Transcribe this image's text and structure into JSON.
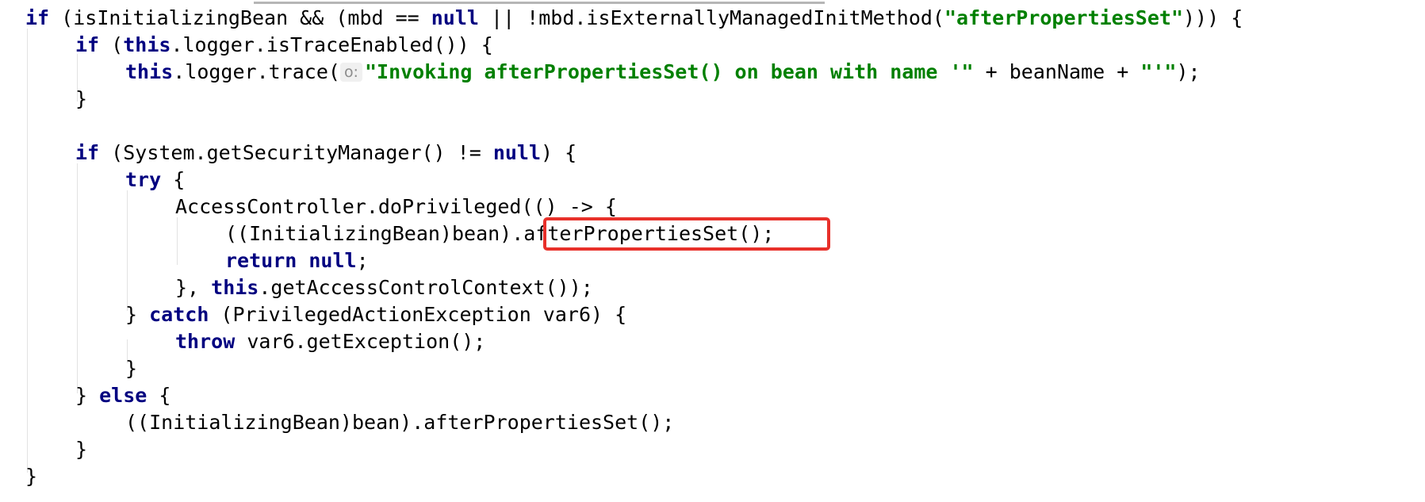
{
  "code": {
    "l1": {
      "if_kw": "if",
      "a": " (isInitializingBean && (mbd == ",
      "null_kw": "null",
      "b": " || !mbd.isExternallyManagedInitMethod(",
      "str": "\"afterPropertiesSet\"",
      "c": "))) {"
    },
    "l2": {
      "if_kw": "if",
      "a": " (",
      "this_kw": "this",
      "b": ".logger.isTraceEnabled()) {"
    },
    "l3": {
      "this_kw": "this",
      "a": ".logger.trace(",
      "hint": "o:",
      "str": "\"Invoking afterPropertiesSet() on bean with name '\"",
      "b": " + beanName + ",
      "str2": "\"'\"",
      "c": ");"
    },
    "l4": {
      "text": "}"
    },
    "l6": {
      "if_kw": "if",
      "a": " (System.getSecurityManager() != ",
      "null_kw": "null",
      "b": ") {"
    },
    "l7": {
      "try_kw": "try",
      "a": " {"
    },
    "l8": {
      "text": "AccessController.doPrivileged(() -> {"
    },
    "l9": {
      "text": "((InitializingBean)bean).afterPropertiesSet();"
    },
    "l10": {
      "return_kw": "return",
      "a": " ",
      "null_kw": "null",
      "b": ";"
    },
    "l11": {
      "a": "}, ",
      "this_kw": "this",
      "b": ".getAccessControlContext());"
    },
    "l12": {
      "a": "} ",
      "catch_kw": "catch",
      "b": " (PrivilegedActionException var6) {"
    },
    "l13": {
      "throw_kw": "throw",
      "a": " var6.getException();"
    },
    "l14": {
      "text": "}"
    },
    "l15": {
      "a": "} ",
      "else_kw": "else",
      "b": " {"
    },
    "l16": {
      "text": "((InitializingBean)bean).afterPropertiesSet();"
    },
    "l17": {
      "text": "}"
    },
    "l18": {
      "text": "}"
    }
  },
  "colors": {
    "keyword": "#000080",
    "string": "#008000",
    "highlight_box": "#e8302a",
    "hint_background": "#f0f0f0"
  }
}
